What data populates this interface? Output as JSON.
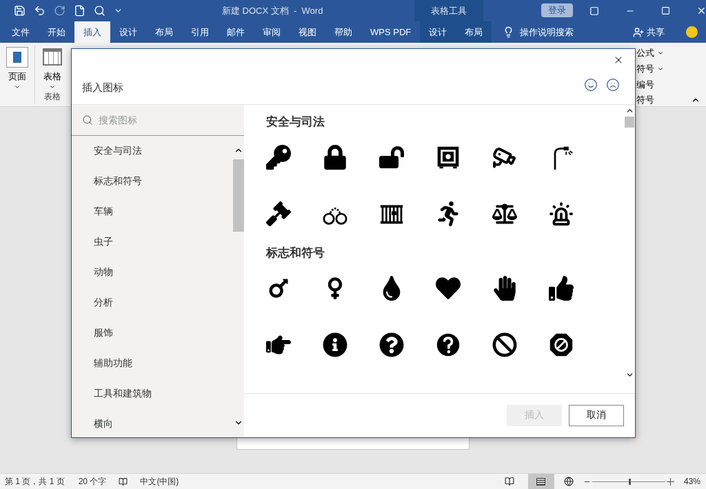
{
  "window": {
    "title": "新建 DOCX 文档  -  Word",
    "context_label": "表格工具",
    "login": "登录"
  },
  "tabs": [
    {
      "label": "文件",
      "selected": false,
      "kind": "normal"
    },
    {
      "label": "开始",
      "selected": false,
      "kind": "normal"
    },
    {
      "label": "插入",
      "selected": true,
      "kind": "normal"
    },
    {
      "label": "设计",
      "selected": false,
      "kind": "normal"
    },
    {
      "label": "布局",
      "selected": false,
      "kind": "normal"
    },
    {
      "label": "引用",
      "selected": false,
      "kind": "normal"
    },
    {
      "label": "邮件",
      "selected": false,
      "kind": "normal"
    },
    {
      "label": "审阅",
      "selected": false,
      "kind": "normal"
    },
    {
      "label": "视图",
      "selected": false,
      "kind": "normal"
    },
    {
      "label": "帮助",
      "selected": false,
      "kind": "normal"
    },
    {
      "label": "WPS PDF",
      "selected": false,
      "kind": "normal"
    },
    {
      "label": "设计",
      "selected": false,
      "kind": "context"
    },
    {
      "label": "布局",
      "selected": false,
      "kind": "context"
    }
  ],
  "tell_me": "操作说明搜索",
  "share": "共享",
  "ribbon": {
    "page": "页面",
    "table": "表格",
    "table_group": "表格",
    "equation": "公式",
    "symbol": "符号",
    "number": "编号",
    "symbols_group": "符号"
  },
  "dialog": {
    "title": "插入图标",
    "search_placeholder": "搜索图标",
    "categories": [
      {
        "label": "安全与司法",
        "selected": false
      },
      {
        "label": "标志和符号",
        "selected": false
      },
      {
        "label": "车辆",
        "selected": false
      },
      {
        "label": "虫子",
        "selected": false
      },
      {
        "label": "动物",
        "selected": false
      },
      {
        "label": "分析",
        "selected": false
      },
      {
        "label": "服饰",
        "selected": false
      },
      {
        "label": "辅助功能",
        "selected": false
      },
      {
        "label": "工具和建筑物",
        "selected": false
      },
      {
        "label": "横向",
        "selected": false
      }
    ],
    "sections": [
      {
        "title": "安全与司法"
      },
      {
        "title": "标志和符号"
      }
    ],
    "insert": {
      "label": "插入",
      "disabled": true
    },
    "cancel": "取消"
  },
  "status_bar": {
    "page": "第 1 页，共 1 页",
    "words": "20 个字",
    "language": "中文(中国)",
    "zoom": "43%",
    "zoom_slider": {
      "level": 0.5
    }
  }
}
